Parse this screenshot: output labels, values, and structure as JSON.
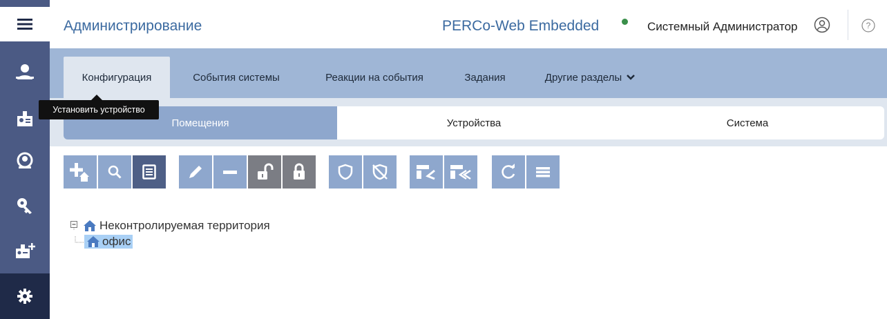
{
  "app": {
    "section_title": "Администрирование",
    "brand": "PERCo-Web Embedded",
    "status_color": "#3a8f4a",
    "user_name": "Системный Администратор",
    "user_icon": "user-circle-icon",
    "help_icon": "help-icon"
  },
  "colors": {
    "sidebar": "#4b5a84",
    "sidebar_active": "#1f2a48",
    "tabbar": "#9fb6d6",
    "accent": "#8ea7cd",
    "toolbar_selected": "#4e5f86",
    "toolbar_gray": "#7b7d84",
    "tree_selected": "#a9d0f5"
  },
  "sidebar": {
    "items": [
      {
        "icon": "menu-icon"
      },
      {
        "icon": "employee-icon"
      },
      {
        "icon": "id-badge-icon"
      },
      {
        "icon": "globe-person-icon"
      },
      {
        "icon": "key-icon"
      },
      {
        "icon": "add-badge-icon"
      },
      {
        "icon": "gear-icon",
        "active": true
      }
    ]
  },
  "tabs": [
    {
      "label": "Конфигурация",
      "active": true
    },
    {
      "label": "События системы"
    },
    {
      "label": "Реакции на события"
    },
    {
      "label": "Задания"
    },
    {
      "label": "Другие разделы"
    }
  ],
  "subtabs": [
    {
      "label": "Помещения",
      "active": true
    },
    {
      "label": "Устройства"
    },
    {
      "label": "Система"
    }
  ],
  "toolbar": {
    "buttons": [
      {
        "icon": "add-room-icon"
      },
      {
        "icon": "search-icon"
      },
      {
        "icon": "install-device-icon",
        "selected": true
      },
      {
        "icon": "edit-icon"
      },
      {
        "icon": "remove-icon"
      },
      {
        "icon": "unlock-icon"
      },
      {
        "icon": "lock-icon"
      },
      {
        "icon": "shield-icon"
      },
      {
        "icon": "shield-off-icon"
      },
      {
        "icon": "device-left-icon"
      },
      {
        "icon": "device-double-left-icon"
      },
      {
        "icon": "refresh-icon"
      },
      {
        "icon": "list-icon"
      }
    ]
  },
  "tooltip": "Установить устройство",
  "tree": {
    "root": "Неконтролируемая территория",
    "child": "офис"
  }
}
